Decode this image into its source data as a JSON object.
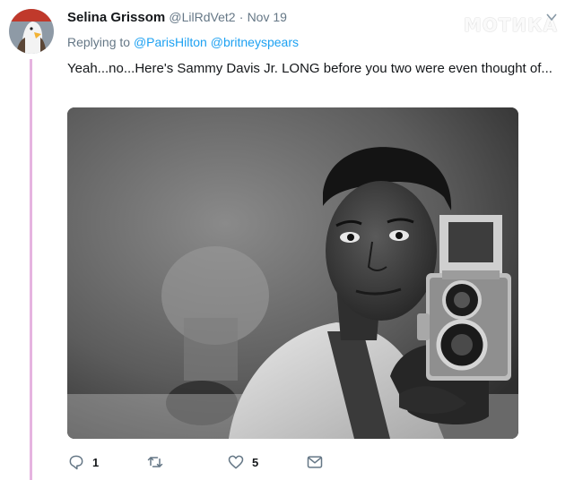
{
  "tweet": {
    "author_name": "Selina Grissom",
    "author_handle": "@LilRdVet2",
    "separator": "·",
    "date": "Nov 19",
    "reply_prefix": "Replying to",
    "reply_mentions": [
      "@ParisHilton",
      "@britneyspears"
    ],
    "text": "Yeah...no...Here's Sammy Davis Jr. LONG before you two were even thought of..."
  },
  "watermark": "МОТИКА",
  "actions": {
    "reply_count": "1",
    "retweet_count": "",
    "like_count": "5"
  },
  "icons": {
    "reply": "reply-icon",
    "retweet": "retweet-icon",
    "like": "heart-icon",
    "dm": "envelope-icon",
    "more": "chevron-down-icon"
  },
  "colors": {
    "link": "#1da1f2",
    "muted": "#657786",
    "thread_line": "#e6b4e0"
  }
}
